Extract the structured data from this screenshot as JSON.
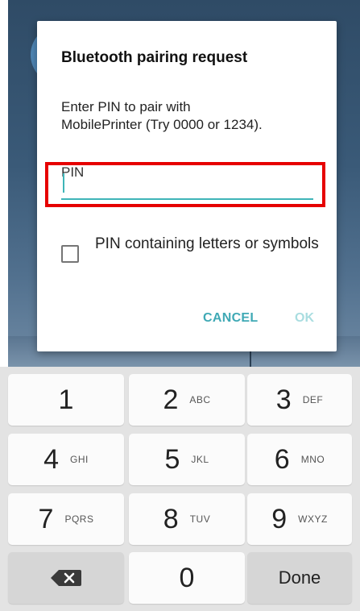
{
  "dialog": {
    "title": "Bluetooth pairing request",
    "message_line1": "Enter PIN to pair with",
    "message_line2": "MobilePrinter (Try 0000 or 1234).",
    "pin_label": "PIN",
    "pin_value": "",
    "checkbox_label": "PIN containing letters or symbols",
    "checkbox_checked": false,
    "cancel_label": "CANCEL",
    "ok_label": "OK"
  },
  "keypad": {
    "keys": [
      {
        "digit": "1",
        "letters": ""
      },
      {
        "digit": "2",
        "letters": "ABC"
      },
      {
        "digit": "3",
        "letters": "DEF"
      },
      {
        "digit": "4",
        "letters": "GHI"
      },
      {
        "digit": "5",
        "letters": "JKL"
      },
      {
        "digit": "6",
        "letters": "MNO"
      },
      {
        "digit": "7",
        "letters": "PQRS"
      },
      {
        "digit": "8",
        "letters": "TUV"
      },
      {
        "digit": "9",
        "letters": "WXYZ"
      },
      {
        "digit": "0",
        "letters": ""
      }
    ],
    "backspace_icon": "backspace-icon",
    "done_label": "Done"
  },
  "colors": {
    "accent": "#3fb5b8",
    "highlight": "#e60000",
    "ok_disabled": "#a9dde0"
  }
}
